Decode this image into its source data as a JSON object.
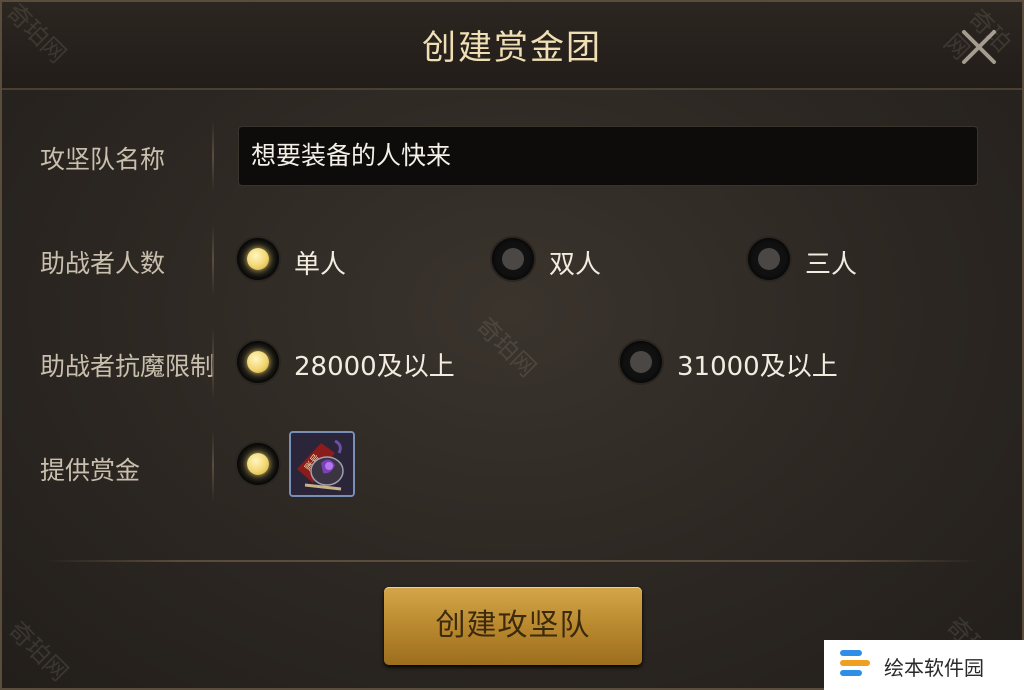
{
  "dialog": {
    "title": "创建赏金团",
    "create_button_label": "创建攻坚队"
  },
  "form": {
    "team_name_label": "攻坚队名称",
    "team_name_value": "想要装备的人快来",
    "helpers_label": "助战者人数",
    "helpers_options": [
      "单人",
      "双人",
      "三人"
    ],
    "helpers_selected": "单人",
    "resist_label": "助战者抗魔限制",
    "resist_options": [
      "28000及以上",
      "31000及以上"
    ],
    "resist_selected": "28000及以上",
    "bounty_label": "提供赏金",
    "bounty_item_icon": "contract-scroll-icon",
    "bounty_item_tag": "账号"
  },
  "watermark": {
    "text": "奇珀网"
  },
  "brand": {
    "text": "绘本软件园"
  },
  "colors": {
    "accent_gold": "#d4a64a",
    "title_text": "#f0dfb4",
    "selected_radio": "#f1d672"
  }
}
